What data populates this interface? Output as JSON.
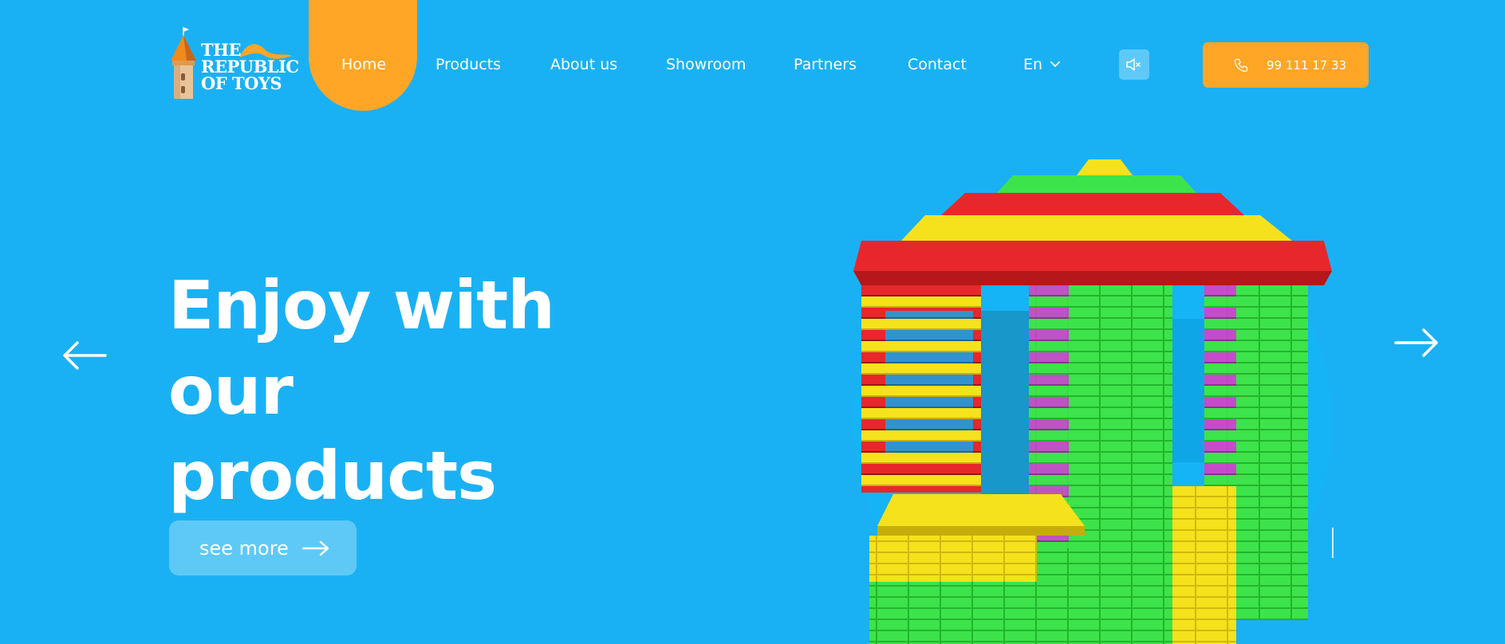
{
  "brand": {
    "logo_lines": [
      "THE",
      "REPUBLIC",
      "OF TOYS"
    ],
    "accent_color": "#ffa626",
    "background_color": "#1ab1f4"
  },
  "nav": {
    "items": [
      {
        "label": "Home",
        "active": true
      },
      {
        "label": "Products"
      },
      {
        "label": "About us"
      },
      {
        "label": "Showroom"
      },
      {
        "label": "Partners"
      },
      {
        "label": "Contact"
      }
    ],
    "language": "En"
  },
  "sound": {
    "icon": "speaker-muted-icon"
  },
  "phone": {
    "icon": "phone-icon",
    "number": "99 111 17 33"
  },
  "hero": {
    "title_line1": "Enjoy with our",
    "title_line2": "products",
    "cta_label": "see more"
  },
  "slider": {
    "prev_icon": "arrow-left-icon",
    "next_icon": "arrow-right-icon"
  }
}
